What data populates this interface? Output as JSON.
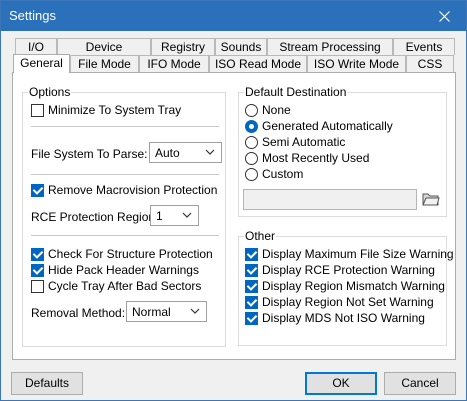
{
  "window": {
    "title": "Settings"
  },
  "tabs_row1": [
    "I/O",
    "Device",
    "Registry",
    "Sounds",
    "Stream Processing",
    "Events"
  ],
  "tabs_row2": [
    "General",
    "File Mode",
    "IFO Mode",
    "ISO Read Mode",
    "ISO Write Mode",
    "CSS"
  ],
  "options": {
    "title": "Options",
    "minimize_to_tray": {
      "label": "Minimize To System Tray",
      "checked": false
    },
    "file_system_label": "File System To Parse:",
    "file_system_value": "Auto",
    "remove_macrovision": {
      "label": "Remove Macrovision Protection",
      "checked": true
    },
    "rce_region_label": "RCE Protection Region:",
    "rce_region_value": "1",
    "check_structure": {
      "label": "Check For Structure Protection",
      "checked": true
    },
    "hide_pack_header": {
      "label": "Hide Pack Header Warnings",
      "checked": true
    },
    "cycle_tray": {
      "label": "Cycle Tray After Bad Sectors",
      "checked": false
    },
    "removal_method_label": "Removal Method:",
    "removal_method_value": "Normal"
  },
  "default_destination": {
    "title": "Default Destination",
    "radios": [
      {
        "label": "None",
        "selected": false
      },
      {
        "label": "Generated Automatically",
        "selected": true
      },
      {
        "label": "Semi Automatic",
        "selected": false
      },
      {
        "label": "Most Recently Used",
        "selected": false
      },
      {
        "label": "Custom",
        "selected": false
      }
    ],
    "path_value": ""
  },
  "other": {
    "title": "Other",
    "items": [
      {
        "label": "Display Maximum File Size Warning",
        "checked": true
      },
      {
        "label": "Display RCE Protection Warning",
        "checked": true
      },
      {
        "label": "Display Region Mismatch Warning",
        "checked": true
      },
      {
        "label": "Display Region Not Set Warning",
        "checked": true
      },
      {
        "label": "Display MDS Not ISO Warning",
        "checked": true
      }
    ]
  },
  "buttons": {
    "defaults": "Defaults",
    "ok": "OK",
    "cancel": "Cancel"
  },
  "colors": {
    "titlebar": "#2b70ba",
    "accent": "#0067c0",
    "default_button_border": "#0078d7"
  }
}
